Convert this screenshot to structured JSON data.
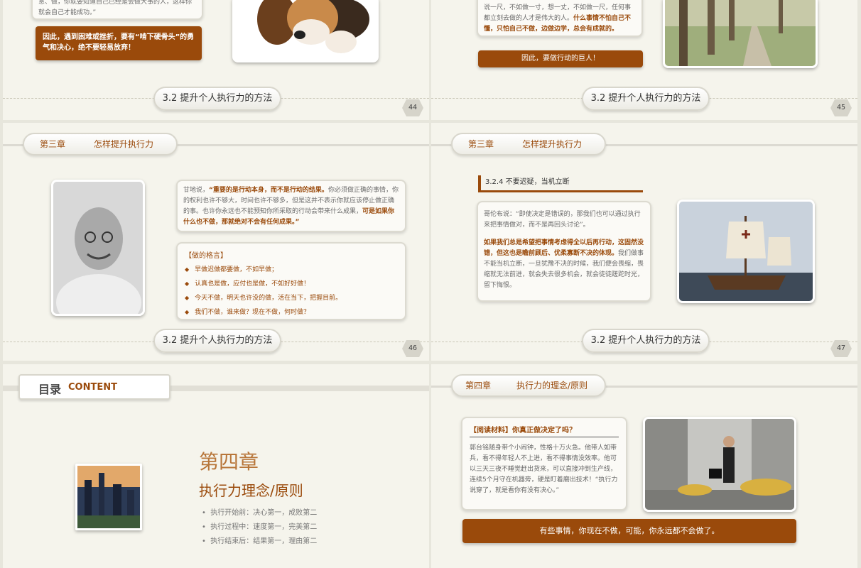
{
  "footer_title": "3.2 提升个人执行力的方法",
  "slide44": {
    "page": "44",
    "text_tail": "意、做，你就要知道自己已经是会做大事的人，这样你就会自己才能成功。”",
    "banner_text": "因此，遇到困难或挫折，要有“啃下硬骨头”的勇气和决心，绝不要轻易放弃！"
  },
  "slide45": {
    "page": "45",
    "text_a": "说一尺，不如做一寸，想一丈，不如做一尺，任何事都立刻去做的人才是伟大的人。",
    "text_b": "什么事情不怕自己不懂，只怕自己不做，边做边学，总会有成就的。",
    "banner_text": "因此，要做行动的巨人！"
  },
  "slide46": {
    "page": "46",
    "chapter_num": "第三章",
    "chapter_name": "怎样提升执行力",
    "quote_intro": "甘地说，",
    "quote_hl": "“重要的是行动本身，而不是行动的结果。",
    "quote_body": "你必须做正确的事情，你的权利也许不够大，时间也许不够多，但是这并不表示你就应该停止做正确的事。也许你永远也不能预知你所采取的行动会带来什么成果，",
    "quote_end": "可是如果你什么也不做，那就绝对不会有任何成果。”",
    "motto_title": "【做的格言】",
    "mottos": [
      "早做迟做都要做，不如早做；",
      "认真也是做，应付也是做，不如好好做！",
      "今天不做，明天也许没的做，活在当下，把握目前。",
      "我们不做，谁来做？现在不做，何时做？"
    ]
  },
  "slide47": {
    "page": "47",
    "chapter_num": "第三章",
    "chapter_name": "怎样提升执行力",
    "section_title": "3.2.4 不要迟疑，当机立断",
    "para1": "哥伦布说：“即使决定是错误的，那我们也可以通过执行来把事情做对，而不是再回头讨论”。",
    "para2_hl": "如果我们总是希望把事情考虑得全以后再行动，这固然没错，但这也是瞻前顾后、优柔寡断不决的体现。",
    "para2_body": "我们做事不能当机立断，一旦犹豫不决的时候，我们便会畏缩，畏缩就无法前进，就会失去很多机会，就会徒徒蹉跎时光，留下悔恨。"
  },
  "slide48": {
    "toc_label": "目录",
    "toc_en": "CONTENT",
    "chapter_num": "第四章",
    "chapter_title": "执行力理念/原则",
    "bullets": [
      "执行开始前：决心第一，成败第二",
      "执行过程中：速度第一，完美第二",
      "执行结束后：结果第一，理由第二"
    ]
  },
  "slide49": {
    "chapter_num": "第四章",
    "chapter_name": "执行力的理念/原则",
    "reading_title": "【阅读材料】你真正做决定了吗？",
    "reading_text": "郭台铭随身带个小闹钟，性格十万火急。他带人如带兵，看不得年轻人不上进，看不得事情没效率。他可以三天三夜不睡觉赶出货来，可以直接冲到生产线，连续5个月守在机器旁，硬是盯着磨出技术！“执行力说穿了，就是看你有没有决心。”",
    "banner_text": "有些事情，你现在不做，可能，你永远都不会做了。"
  }
}
